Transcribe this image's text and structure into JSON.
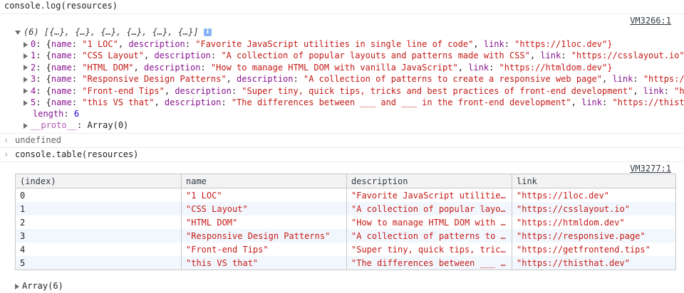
{
  "cmd1": "console.log(resources)",
  "vm1": "VM3266:1",
  "array_summary": "(6) [{…}, {…}, {…}, {…}, {…}, {…}]",
  "info_icon": "i",
  "log_rows": [
    {
      "index": "0",
      "name": "\"1 LOC\"",
      "description": "\"Favorite JavaScript utilities in single line of code\"",
      "link": "\"https://1loc.dev\"}"
    },
    {
      "index": "1",
      "name": "\"CSS Layout\"",
      "description": "\"A collection of popular layouts and patterns made with CSS\"",
      "link": "\"https://csslayout.io\"}"
    },
    {
      "index": "2",
      "name": "\"HTML DOM\"",
      "description": "\"How to manage HTML DOM with vanilla JavaScript\"",
      "link": "\"https://htmldom.dev\"}"
    },
    {
      "index": "3",
      "name": "\"Responsive Design Patterns\"",
      "description": "\"A collection of patterns to create a responsive web page\"",
      "link": "\"https://re…"
    },
    {
      "index": "4",
      "name": "\"Front-end Tips\"",
      "description": "\"Super tiny, quick tips, tricks and best practices of front-end development\"",
      "link": "\"http…"
    },
    {
      "index": "5",
      "name": "\"this VS that\"",
      "description": "\"The differences between ___ and ___ in the front-end development\"",
      "link": "\"https://thisthat…"
    }
  ],
  "length_key": "length",
  "length_value": "6",
  "proto_key": "__proto__",
  "proto_value": "Array(0)",
  "undefined_text": "undefined",
  "cmd2": "console.table(resources)",
  "vm2": "VM3277:1",
  "table": {
    "headers": [
      "(index)",
      "name",
      "description",
      "link"
    ],
    "rows": [
      [
        "0",
        "\"1 LOC\"",
        "\"Favorite JavaScript utilities …",
        "\"https://1loc.dev\""
      ],
      [
        "1",
        "\"CSS Layout\"",
        "\"A collection of popular layout…",
        "\"https://csslayout.io\""
      ],
      [
        "2",
        "\"HTML DOM\"",
        "\"How to manage HTML DOM with va…",
        "\"https://htmldom.dev\""
      ],
      [
        "3",
        "\"Responsive Design Patterns\"",
        "\"A collection of patterns to cr…",
        "\"https://responsive.page\""
      ],
      [
        "4",
        "\"Front-end Tips\"",
        "\"Super tiny, quick tips, tricks…",
        "\"https://getfrontend.tips\""
      ],
      [
        "5",
        "\"this VS that\"",
        "\"The differences between ___ an…",
        "\"https://thisthat.dev\""
      ]
    ]
  },
  "array_footer": "Array(6)",
  "colors": {
    "key": "#881391",
    "string": "#c41a16",
    "number": "#1c00cf",
    "row_stripe": "#f2f7fd"
  }
}
